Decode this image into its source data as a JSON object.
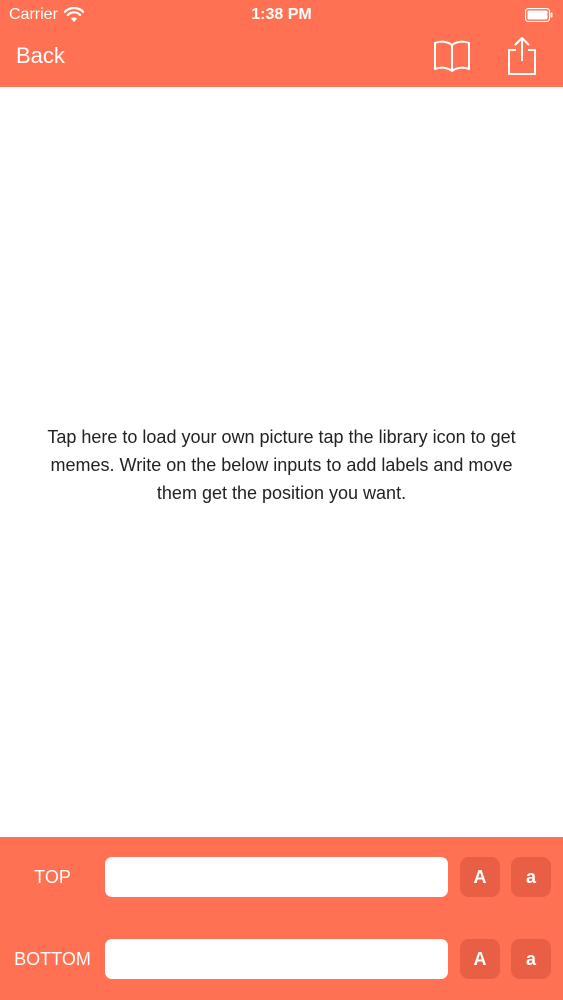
{
  "status_bar": {
    "carrier": "Carrier",
    "time": "1:38 PM",
    "wifi_icon": "wifi-icon",
    "battery_icon": "battery-icon"
  },
  "nav": {
    "back_label": "Back",
    "library_icon": "book-icon",
    "share_icon": "share-icon"
  },
  "canvas": {
    "hint": "Tap here to load your own picture tap the library icon to get memes. Write on the below inputs to add labels and move them get the position you want."
  },
  "controls": {
    "top": {
      "label": "TOP",
      "value": "",
      "upper_label": "A",
      "lower_label": "a"
    },
    "bottom": {
      "label": "BOTTOM",
      "value": "",
      "upper_label": "A",
      "lower_label": "a"
    }
  },
  "colors": {
    "accent": "#ff7152",
    "button": "#e85f45",
    "text": "#222222"
  }
}
